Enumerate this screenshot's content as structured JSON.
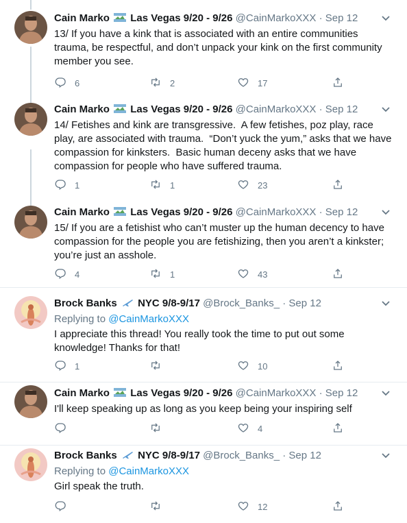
{
  "tweets": [
    {
      "author": "Cain Marko",
      "location": "Las Vegas 9/20 - 9/26",
      "handle": "@CainMarkoXXX",
      "dot": "·",
      "date": "Sep 12",
      "text": "13/ If you have a kink that is associated with an entire communities trauma, be respectful, and don’t unpack your kink on the first community member you see.",
      "replies": "6",
      "retweets": "2",
      "likes": "17"
    },
    {
      "author": "Cain Marko",
      "location": "Las Vegas 9/20 - 9/26",
      "handle": "@CainMarkoXXX",
      "dot": "·",
      "date": "Sep 12",
      "text": "14/ Fetishes and kink are transgressive.  A few fetishes, poz play, race play, are associated with trauma.  “Don’t yuck the yum,” asks that we have compassion for kinksters.  Basic human deceny asks that we have compassion for people who have suffered trauma.",
      "replies": "1",
      "retweets": "1",
      "likes": "23"
    },
    {
      "author": "Cain Marko",
      "location": "Las Vegas 9/20 - 9/26",
      "handle": "@CainMarkoXXX",
      "dot": "·",
      "date": "Sep 12",
      "text": "15/ If you are a fetishist who can’t muster up the human decency to have compassion for the people you are fetishizing, then you aren’t a kinkster; you’re just an asshole.",
      "replies": "4",
      "retweets": "1",
      "likes": "43"
    },
    {
      "author": "Brock Banks",
      "location": "NYC 9/8-9/17",
      "handle": "@Brock_Banks_",
      "dot": "·",
      "date": "Sep 12",
      "replying_label": "Replying to",
      "replying_to": "@CainMarkoXXX",
      "text": "I appreciate this thread! You really took the time to put out some knowledge! Thanks for that!",
      "replies": "1",
      "retweets": "",
      "likes": "10"
    },
    {
      "author": "Cain Marko",
      "location": "Las Vegas 9/20 - 9/26",
      "handle": "@CainMarkoXXX",
      "dot": "·",
      "date": "Sep 12",
      "text": "I'll keep speaking up as long as you keep being your inspiring self",
      "replies": "",
      "retweets": "",
      "likes": "4"
    },
    {
      "author": "Brock Banks",
      "location": "NYC 9/8-9/17",
      "handle": "@Brock_Banks_",
      "dot": "·",
      "date": "Sep 12",
      "replying_label": "Replying to",
      "replying_to": "@CainMarkoXXX",
      "text": "Girl speak the truth.",
      "replies": "",
      "retweets": "",
      "likes": "12"
    }
  ],
  "icons": {
    "reply": "reply-icon",
    "retweet": "retweet-icon",
    "like": "heart-icon",
    "share": "share-icon",
    "caret": "chevron-down-icon",
    "flag_cain": "las-vegas-flag-emoji",
    "flag_brock": "airplane-emoji"
  },
  "colors": {
    "text": "#14171a",
    "secondary": "#657786",
    "link": "#1b95e0",
    "divider": "#e6ecf0",
    "thread_line": "#ccd6dd"
  }
}
